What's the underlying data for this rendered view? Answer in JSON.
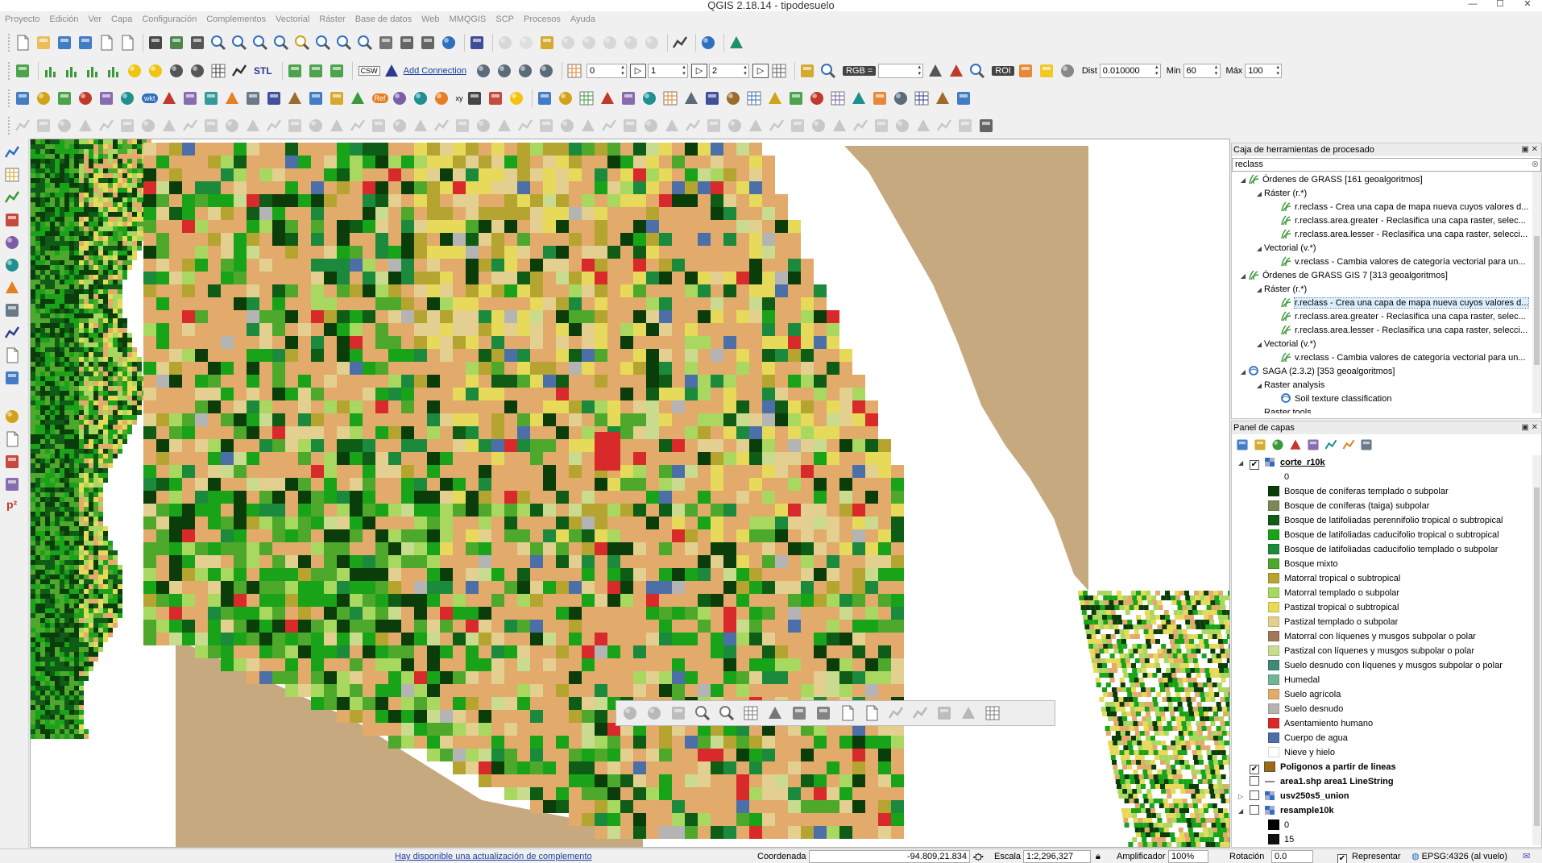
{
  "window": {
    "title": "QGIS 2.18.14 - tipodesuelo",
    "minimize": "—",
    "maximize": "☐",
    "close": "✕"
  },
  "menu": [
    "Proyecto",
    "Edición",
    "Ver",
    "Capa",
    "Configuración",
    "Complementos",
    "Vectorial",
    "Ráster",
    "Base de datos",
    "Web",
    "MMQGIS",
    "SCP",
    "Procesos",
    "Ayuda"
  ],
  "toolbar": {
    "add_connection": "Add Connection",
    "csw": "CSW",
    "spin_a": "0",
    "spin_b": "1",
    "spin_c": "2",
    "rgb_label": "RGB =",
    "roi_label": "ROI",
    "dist_label": "Dist",
    "dist_value": "0.010000",
    "min_label": "Min",
    "min_value": "60",
    "max_label": "Máx",
    "max_value": "100",
    "wkt": "wkt",
    "xy": "xy",
    "ref": "Ref",
    "stl": "STL"
  },
  "processing_panel": {
    "title": "Caja de herramientas de procesado",
    "search_value": "reclass",
    "tree": [
      {
        "level": 0,
        "twisty": "◢",
        "text": "Órdenes de GRASS [161 geoalgoritmos]",
        "icon": "grass-icon"
      },
      {
        "level": 1,
        "twisty": "◢",
        "text": "Ráster (r.*)",
        "icon": ""
      },
      {
        "level": 2,
        "twisty": "",
        "text": "r.reclass - Crea una capa de mapa nueva cuyos valores d...",
        "icon": "grass-icon"
      },
      {
        "level": 2,
        "twisty": "",
        "text": "r.reclass.area.greater - Reclasifica una capa raster, selec...",
        "icon": "grass-icon"
      },
      {
        "level": 2,
        "twisty": "",
        "text": "r.reclass.area.lesser - Reclasifica una capa raster, selecci...",
        "icon": "grass-icon"
      },
      {
        "level": 1,
        "twisty": "◢",
        "text": "Vectorial (v.*)",
        "icon": ""
      },
      {
        "level": 2,
        "twisty": "",
        "text": "v.reclass - Cambia valores de categoría vectorial para un...",
        "icon": "grass-icon"
      },
      {
        "level": 0,
        "twisty": "◢",
        "text": "Órdenes de GRASS GIS 7 [313 geoalgoritmos]",
        "icon": "grass-icon"
      },
      {
        "level": 1,
        "twisty": "◢",
        "text": "Ráster (r.*)",
        "icon": ""
      },
      {
        "level": 2,
        "twisty": "",
        "text": "r.reclass - Crea una capa de mapa nueva cuyos valores d...",
        "icon": "grass-icon",
        "selected": true
      },
      {
        "level": 2,
        "twisty": "",
        "text": "r.reclass.area.greater - Reclasifica una capa raster, selec...",
        "icon": "grass-icon"
      },
      {
        "level": 2,
        "twisty": "",
        "text": "r.reclass.area.lesser - Reclasifica una capa raster, selecci...",
        "icon": "grass-icon"
      },
      {
        "level": 1,
        "twisty": "◢",
        "text": "Vectorial (v.*)",
        "icon": ""
      },
      {
        "level": 2,
        "twisty": "",
        "text": "v.reclass - Cambia valores de categoría vectorial para un...",
        "icon": "grass-icon"
      },
      {
        "level": 0,
        "twisty": "◢",
        "text": "SAGA (2.3.2) [353 geoalgoritmos]",
        "icon": "saga-icon"
      },
      {
        "level": 1,
        "twisty": "◢",
        "text": "Raster analysis",
        "icon": ""
      },
      {
        "level": 2,
        "twisty": "",
        "text": "Soil texture classification",
        "icon": "saga-icon"
      },
      {
        "level": 1,
        "twisty": "",
        "text": "Raster tools",
        "icon": ""
      }
    ]
  },
  "layers_panel": {
    "title": "Panel de capas",
    "layers": [
      {
        "name": "corte_r10k",
        "checked": true,
        "expanded": true,
        "underline": true,
        "legend": [
          {
            "label": "0",
            "color": ""
          },
          {
            "label": "Bosque de coníferas templado o subpolar",
            "color": "#0b3d0b"
          },
          {
            "label": "Bosque de coníferas (taiga) subpolar",
            "color": "#7a8a55"
          },
          {
            "label": "Bosque de latifoliadas perennifolio tropical o subtropical",
            "color": "#0e5c16"
          },
          {
            "label": "Bosque de latifoliadas caducifolio tropical o subtropical",
            "color": "#18a318"
          },
          {
            "label": "Bosque de latifoliadas caducifolio templado o subpolar",
            "color": "#1c8a3c"
          },
          {
            "label": "Bosque mixto",
            "color": "#4ea82c"
          },
          {
            "label": "Matorral tropical o subtropical",
            "color": "#b5a530"
          },
          {
            "label": "Matorral templado o subpolar",
            "color": "#a8d860"
          },
          {
            "label": "Pastizal tropical o subtropical",
            "color": "#e7d95a"
          },
          {
            "label": "Pastizal templado o subpolar",
            "color": "#e3cf8f"
          },
          {
            "label": "Matorral con líquenes y musgos subpolar o polar",
            "color": "#a0785a"
          },
          {
            "label": "Pastizal con líquenes y musgos subpolar o polar",
            "color": "#c9db8f"
          },
          {
            "label": "Suelo desnudo con líquenes y musgos subpolar o polar",
            "color": "#3e8a73"
          },
          {
            "label": "Humedal",
            "color": "#74b494"
          },
          {
            "label": "Suelo agrícola",
            "color": "#e2aa6b"
          },
          {
            "label": "Suelo desnudo",
            "color": "#b4b4b4"
          },
          {
            "label": "Asentamiento humano",
            "color": "#d82a2a"
          },
          {
            "label": "Cuerpo de agua",
            "color": "#4d6fa8"
          },
          {
            "label": "Nieve y hielo",
            "color": "#ffffff"
          }
        ]
      },
      {
        "name": "Poligonos a partir de lineas",
        "checked": true,
        "expanded": false,
        "swatch": "#a0690e"
      },
      {
        "name": "area1.shp area1 LineString",
        "checked": false,
        "expanded": false,
        "line": true
      },
      {
        "name": "usv250s5_union",
        "checked": false,
        "expanded": false,
        "collapsed_twisty": true
      },
      {
        "name": "resample10k",
        "checked": false,
        "expanded": true,
        "legend_first": "0",
        "legend_second": "15"
      }
    ]
  },
  "statusbar": {
    "plugin_update": "Hay disponible una actualización de complemento",
    "coord_label": "Coordenada",
    "coord_value": "-94.809,21.834",
    "scale_label": "Escala",
    "scale_value": "1:2,296,327",
    "magnifier_label": "Amplificador",
    "magnifier_value": "100%",
    "rotation_label": "Rotación",
    "rotation_value": "0.0",
    "render_label": "Representar",
    "crs_label": "EPSG:4326 (al vuelo)"
  },
  "map": {
    "palette": [
      "#0b3d0b",
      "#18a318",
      "#0e5c16",
      "#1c8a3c",
      "#4ea82c",
      "#b5a530",
      "#a8d860",
      "#e7d95a",
      "#e3cf8f",
      "#e2aa6b",
      "#b4b4b4",
      "#d82a2a",
      "#4d6fa8",
      "#c9db8f"
    ],
    "sea_color": "#c6a97e"
  }
}
